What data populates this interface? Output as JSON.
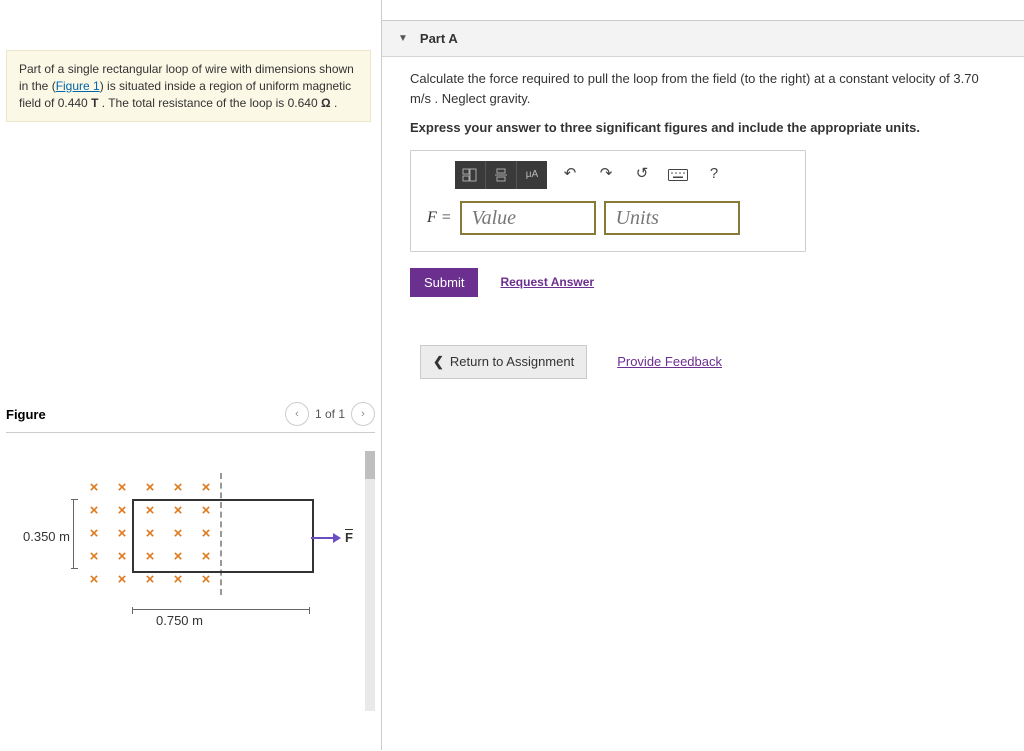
{
  "problem": {
    "text_pre": "Part of a single rectangular loop of wire with dimensions shown in the (",
    "figure_link": "Figure 1",
    "text_mid1": ") is situated inside a region of uniform magnetic field of 0.440 ",
    "unit_T": "T",
    "text_mid2": " . The total resistance of the loop is 0.640 ",
    "unit_ohm": "Ω",
    "text_end": " ."
  },
  "figure": {
    "title": "Figure",
    "pager": "1 of 1",
    "dim_left": "0.350 m",
    "dim_bottom": "0.750 m",
    "force_label": "F"
  },
  "part": {
    "label": "Part A",
    "question": "Calculate the force required to pull the loop from the field (to the right) at a constant velocity of 3.70 m/s . Neglect gravity.",
    "instruction": "Express your answer to three significant figures and include the appropriate units."
  },
  "answer": {
    "var": "F =",
    "value_placeholder": "Value",
    "units_placeholder": "Units",
    "toolbar_help": "?",
    "toolbar_muA": "μA"
  },
  "actions": {
    "submit": "Submit",
    "request_answer": "Request Answer",
    "return": "Return to Assignment",
    "feedback": "Provide Feedback"
  }
}
